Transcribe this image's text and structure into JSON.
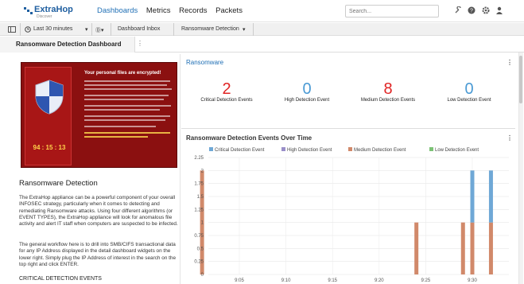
{
  "topbar": {
    "logo_name": "ExtraHop",
    "logo_sub": "Discover",
    "nav": [
      {
        "label": "Dashboards",
        "active": true
      },
      {
        "label": "Metrics",
        "active": false
      },
      {
        "label": "Records",
        "active": false
      },
      {
        "label": "Packets",
        "active": false
      }
    ],
    "search_placeholder": "Search...",
    "icons": [
      "wrench-icon",
      "help-icon",
      "gear-icon",
      "user-icon"
    ]
  },
  "subbar": {
    "time_range": "Last 30 minutes",
    "breadcrumb_1": "Dashboard Inbox",
    "breadcrumb_2": "Ransomware Detection"
  },
  "dashboard": {
    "title": "Ransomware Detection Dashboard"
  },
  "left_panel": {
    "image": {
      "title": "Your personal files are encrypted!",
      "timer": "94 : 15 : 13"
    },
    "heading": "Ransomware Detection",
    "paragraph1": "The ExtraHop appliance can be a powerful component of your overall INFOSEC strategy, particularly when it comes to detecting and remediating Ransomware attacks. Using four different algorithms (or EVENT TYPES), the ExtraHop appliance will look for anomalous file activity and alert IT staff when computers are suspected to be infected.",
    "paragraph2": "The general workflow here is to drill into SMB/CIFS transactional data for any IP Address displayed in the detail dashboard widgets on the lower right. Simply plug the IP Address of interest in the search on the top right and click ENTER.",
    "section": "CRITICAL DETECTION EVENTS"
  },
  "ransomware_panel": {
    "title": "Ransomware",
    "stats": [
      {
        "value": "2",
        "label": "Critical Detection Events",
        "color": "#e02424"
      },
      {
        "value": "0",
        "label": "High Detection Event",
        "color": "#4a9ad4"
      },
      {
        "value": "8",
        "label": "Medium Detection Events",
        "color": "#e02424"
      },
      {
        "value": "0",
        "label": "Low Detection Event",
        "color": "#4a9ad4"
      }
    ]
  },
  "chart_panel": {
    "title": "Ransomware Detection Events Over Time"
  },
  "chart_data": {
    "type": "bar",
    "title": "Ransomware Detection Events Over Time",
    "ylim": [
      0,
      2.25
    ],
    "yticks": [
      "2.25",
      "2",
      "1.75",
      "1.5",
      "1.25",
      "1",
      "0.75",
      "0.5",
      "0.25",
      "0"
    ],
    "xticks": [
      "9:05",
      "9:10",
      "9:15",
      "9:20",
      "9:25",
      "9:30"
    ],
    "legend_position": "top",
    "series": [
      {
        "name": "Critical Detection Event",
        "color": "#6fa8d6"
      },
      {
        "name": "High Detection Event",
        "color": "#9a8fc9"
      },
      {
        "name": "Medium Detection Event",
        "color": "#d1896a"
      },
      {
        "name": "Low Detection Event",
        "color": "#7cc276"
      }
    ],
    "bars": [
      {
        "time": "9:01",
        "segments": [
          {
            "series": "Medium Detection Event",
            "value": 2
          }
        ]
      },
      {
        "time": "9:24",
        "segments": [
          {
            "series": "Medium Detection Event",
            "value": 1
          }
        ]
      },
      {
        "time": "9:29",
        "segments": [
          {
            "series": "Medium Detection Event",
            "value": 1
          }
        ]
      },
      {
        "time": "9:30",
        "segments": [
          {
            "series": "Medium Detection Event",
            "value": 1
          },
          {
            "series": "Critical Detection Event",
            "value": 1
          }
        ]
      },
      {
        "time": "9:32",
        "segments": [
          {
            "series": "Medium Detection Event",
            "value": 1
          },
          {
            "series": "Critical Detection Event",
            "value": 1
          }
        ]
      }
    ],
    "grid": true
  }
}
